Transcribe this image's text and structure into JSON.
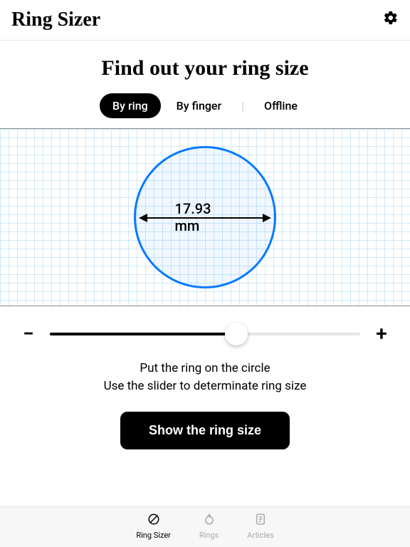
{
  "header": {
    "title": "Ring Sizer"
  },
  "hero": {
    "heading": "Find out your ring size"
  },
  "tabs": {
    "byRing": "By ring",
    "byFinger": "By finger",
    "offline": "Offline"
  },
  "measurement": {
    "diameter_label": "17.93 mm"
  },
  "instructions": {
    "line1": "Put the ring on the circle",
    "line2": "Use the slider to determinate ring size"
  },
  "cta": {
    "show": "Show the ring size"
  },
  "nav": {
    "sizer": "Ring Sizer",
    "rings": "Rings",
    "articles": "Articles"
  },
  "slider": {
    "position_percent": 60
  },
  "colors": {
    "accent": "#007aff",
    "primary": "#000000"
  }
}
